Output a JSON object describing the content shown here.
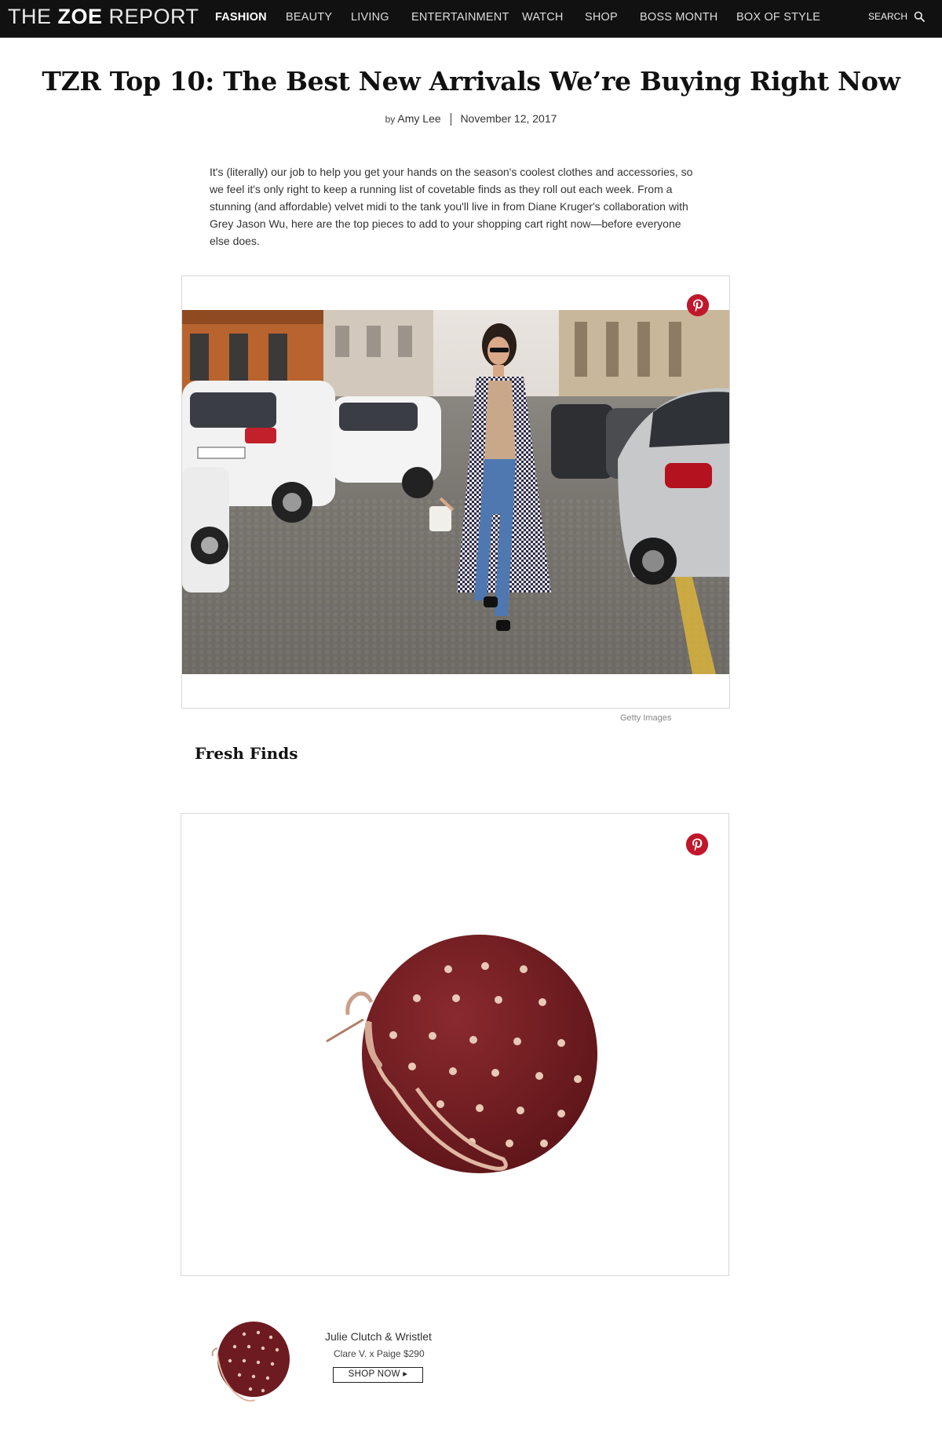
{
  "brand": {
    "part1": "THE ",
    "part2": "ZOE",
    "part3": " REPORT"
  },
  "nav": {
    "items": [
      {
        "label": "FASHION",
        "active": true
      },
      {
        "label": "BEAUTY"
      },
      {
        "label": "LIVING"
      },
      {
        "label": "ENTERTAINMENT"
      },
      {
        "label": "WATCH"
      },
      {
        "label": "SHOP"
      },
      {
        "label": "BOSS MONTH"
      },
      {
        "label": "BOX OF STYLE"
      }
    ],
    "search_label": "SEARCH"
  },
  "article": {
    "title": "TZR Top 10: The Best New Arrivals We’re Buying Right Now",
    "by": "by",
    "author": "Amy Lee",
    "date": "November 12, 2017",
    "intro": "It's (literally) our job to help you get your hands on the season's coolest clothes and accessories, so we feel it's only right to keep a running list of covetable finds as they roll out each week. From a stunning (and affordable) velvet midi to the tank you'll live in from Diane Kruger's collaboration with Grey Jason Wu, here are the top pieces to add to your shopping cart right now—before everyone else does.",
    "image_credit": "Getty Images",
    "section_heading": "Fresh Finds"
  },
  "product": {
    "name": "Julie Clutch & Wristlet",
    "brand_price": "Clare V. x Paige $290",
    "shop_label": "SHOP NOW ▸"
  },
  "colors": {
    "topbar": "#111111",
    "pinterest": "#c0172b",
    "clutch": "#7a1f24"
  }
}
